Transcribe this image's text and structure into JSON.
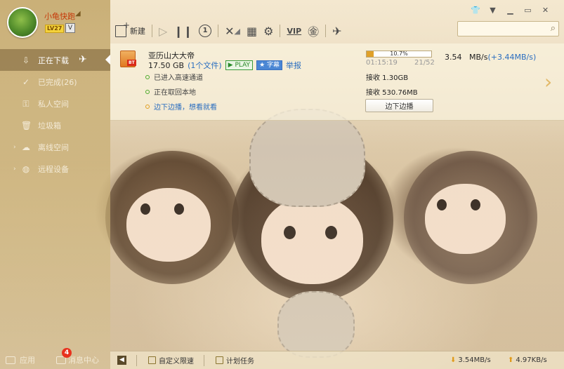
{
  "user": {
    "name": "小龟快跑",
    "level": "LV27",
    "vip_mark": "V"
  },
  "sidebar": {
    "items": [
      {
        "label": "正在下载",
        "icon": "download-icon"
      },
      {
        "label": "已完成(26)",
        "icon": "check-circle-icon"
      },
      {
        "label": "私人空间",
        "icon": "lock-icon"
      },
      {
        "label": "垃圾箱",
        "icon": "trash-icon"
      },
      {
        "label": "离线空间",
        "icon": "cloud-icon"
      },
      {
        "label": "远程设备",
        "icon": "globe-icon"
      }
    ],
    "apps_label": "应用",
    "msg_label": "消息中心",
    "msg_count": "4"
  },
  "toolbar": {
    "new_label": "新建",
    "vip_label": "VIP"
  },
  "search": {
    "placeholder": ""
  },
  "task": {
    "name": "亚历山大大帝",
    "size": "17.50 GB",
    "file_count": "(1个文件)",
    "play_label": "PLAY",
    "sub_label": "字幕",
    "report_label": "举报",
    "bt_tag": "BT",
    "status_1": "已进入高速通道",
    "status_2": "正在取回本地",
    "status_3": "边下边播，想看就看",
    "progress_label": "10.7%",
    "progress_value": 0.107,
    "speed": "3.54",
    "speed_unit": "MB/s",
    "speed_extra": "(+3.44MB/s)",
    "elapsed": "01:15:19",
    "pieces": "21/52",
    "recv_1": "接收 1.30GB",
    "recv_2": "接收 530.76MB",
    "action_label": "边下边播"
  },
  "statusbar": {
    "custom_limit": "自定义限速",
    "schedule": "计划任务",
    "down_speed": "3.54MB/s",
    "up_speed": "4.97KB/s"
  },
  "colors": {
    "accent": "#e0a028",
    "link": "#2a6ec0",
    "sidebar": "#be a05f"
  }
}
